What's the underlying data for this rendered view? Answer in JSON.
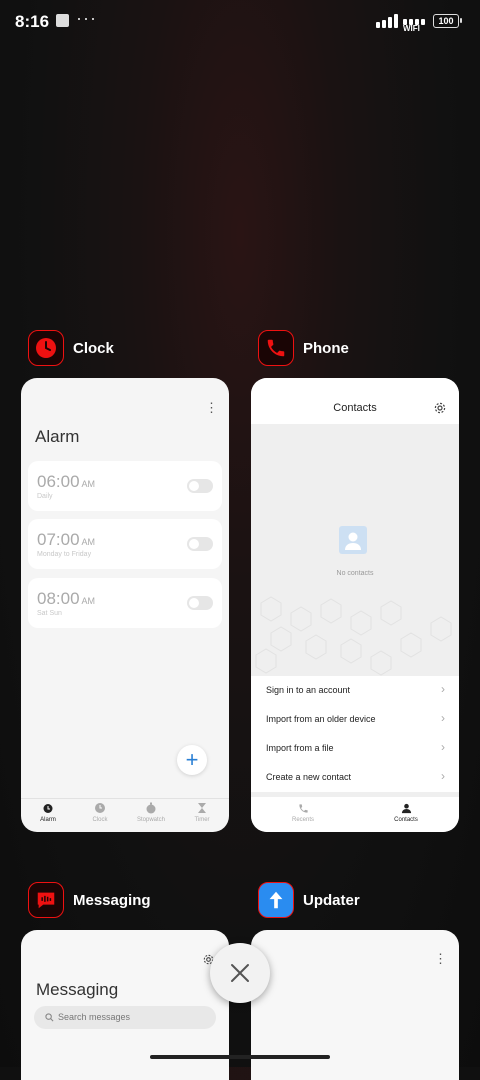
{
  "status_bar": {
    "time": "8:16",
    "dots": "···",
    "wifi_label": "WIFI",
    "battery": "100"
  },
  "apps": {
    "clock": {
      "name": "Clock",
      "screen_title": "Alarm",
      "alarms": [
        {
          "time": "06:00",
          "ampm": "AM",
          "days": "Daily"
        },
        {
          "time": "07:00",
          "ampm": "AM",
          "days": "Monday to Friday"
        },
        {
          "time": "08:00",
          "ampm": "AM",
          "days": "Sat Sun"
        }
      ],
      "tabs": [
        "Alarm",
        "Clock",
        "Stopwatch",
        "Timer"
      ]
    },
    "phone": {
      "name": "Phone",
      "screen_title": "Contacts",
      "empty_text": "No contacts",
      "menu": [
        "Sign in to an account",
        "Import from an older device",
        "Import from a file",
        "Create a new contact"
      ],
      "tabs": [
        "Recents",
        "Contacts"
      ]
    },
    "messaging": {
      "name": "Messaging",
      "screen_title": "Messaging",
      "search_placeholder": "Search messages"
    },
    "updater": {
      "name": "Updater"
    }
  },
  "colors": {
    "accent_red": "#e11111",
    "updater_blue": "#2a8cf0",
    "add_button_blue": "#2a7fd4"
  },
  "icons": {
    "close": "×",
    "add": "+",
    "kebab": "⋮",
    "chevron": "›"
  }
}
